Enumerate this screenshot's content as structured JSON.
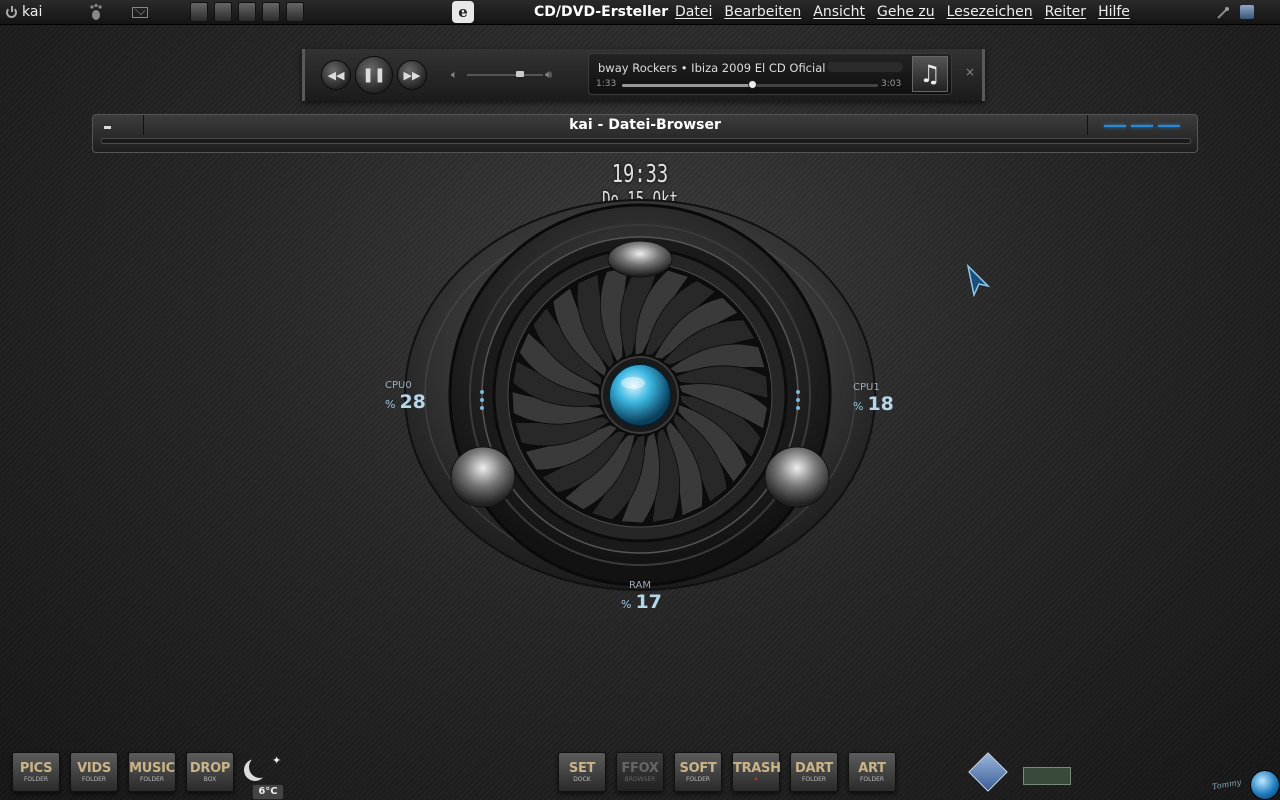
{
  "top_panel": {
    "user_name": "kai",
    "app_name": "CD/DVD-Ersteller",
    "app_logo_glyph": "e",
    "menu": [
      "Datei",
      "Bearbeiten",
      "Ansicht",
      "Gehe zu",
      "Lesezeichen",
      "Reiter",
      "Hilfe"
    ]
  },
  "player": {
    "track_title": "bway Rockers • Ibiza 2009 El CD Oficial",
    "time_elapsed": "1:33",
    "time_total": "3:03",
    "progress": 0.508,
    "volume": 0.7,
    "prev_glyph": "◀◀",
    "pause_glyph": "❚❚",
    "next_glyph": "▶▶",
    "close_glyph": "×",
    "album_glyph": "♫"
  },
  "file_browser": {
    "title": "kai - Datei-Browser"
  },
  "clock": {
    "time": "19:33",
    "date": "Do 15 Okt"
  },
  "system_monitor": {
    "cpu0": {
      "label": "CPU0",
      "unit": "%",
      "value": "28"
    },
    "cpu1": {
      "label": "CPU1",
      "unit": "%",
      "value": "18"
    },
    "ram": {
      "label": "RAM",
      "unit": "%",
      "value": "17"
    }
  },
  "dock": {
    "left": [
      {
        "main": "PICS",
        "sub": "FOLDER"
      },
      {
        "main": "VIDS",
        "sub": "FOLDER"
      },
      {
        "main": "MUSIC",
        "sub": "FOLDER"
      },
      {
        "main": "DROP",
        "sub": "BOX"
      }
    ],
    "center": [
      {
        "main": "SET",
        "sub": "DOCK"
      },
      {
        "main": "FFOX",
        "sub": "BROWSER"
      },
      {
        "main": "SOFT",
        "sub": "FOLDER"
      },
      {
        "main": "TRASH",
        "sub": ""
      },
      {
        "main": "DART",
        "sub": "FOLDER"
      },
      {
        "main": "ART",
        "sub": "FOLDER"
      }
    ]
  },
  "weather": {
    "temperature": "6°C"
  },
  "signature": "Tommy",
  "colors": {
    "accent_blue": "#2a8ad6",
    "dock_label": "#c9b487",
    "stat_text": "#b6d6ea"
  }
}
